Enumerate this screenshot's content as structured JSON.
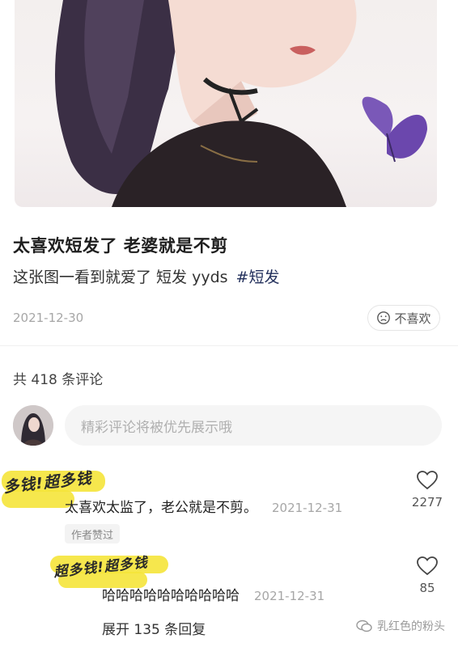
{
  "post": {
    "title": "太喜欢短发了 老婆就是不剪",
    "body": "这张图一看到就爱了 短发 yyds",
    "hashtag": "#短发",
    "date": "2021-12-30",
    "dislike_label": "不喜欢"
  },
  "comments_header": {
    "count_text": "共 418 条评论"
  },
  "comment_input": {
    "placeholder": "精彩评论将被优先展示哦"
  },
  "comments": [
    {
      "username_scribble": "多钱!超多钱",
      "text": "太喜欢太监了，老公就是不剪。",
      "date": "2021-12-31",
      "likes": "2277",
      "badge": "作者赞过"
    },
    {
      "username_scribble": "超多钱!超多钱",
      "text": "哈哈哈哈哈哈哈哈哈哈",
      "date": "2021-12-31",
      "likes": "85"
    }
  ],
  "replies": {
    "expand_label": "展开 135 条回复"
  },
  "watermark": {
    "text": "乳红色的粉头"
  },
  "colors": {
    "hashtag": "#23305c",
    "scribble_highlight": "#f5e43a",
    "muted": "#a6a6a6"
  }
}
